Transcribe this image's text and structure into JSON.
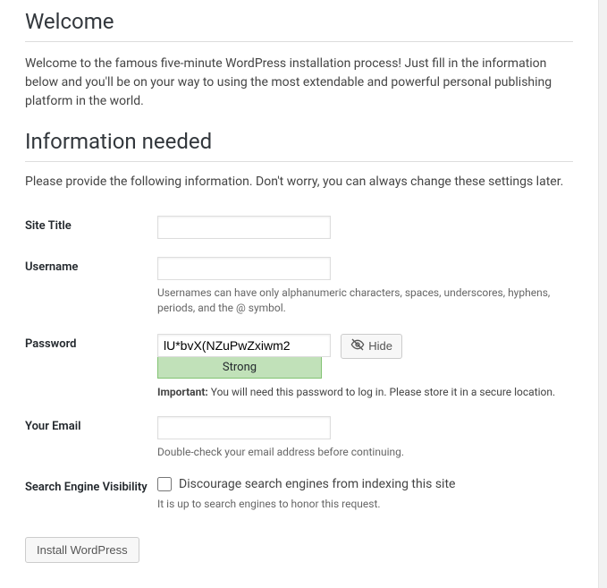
{
  "headings": {
    "welcome": "Welcome",
    "info_needed": "Information needed"
  },
  "intro_text": "Welcome to the famous five-minute WordPress installation process! Just fill in the information below and you'll be on your way to using the most extendable and powerful personal publishing platform in the world.",
  "sub_text": "Please provide the following information. Don't worry, you can always change these settings later.",
  "form": {
    "site_title": {
      "label": "Site Title",
      "value": ""
    },
    "username": {
      "label": "Username",
      "value": "",
      "hint": "Usernames can have only alphanumeric characters, spaces, underscores, hyphens, periods, and the @ symbol."
    },
    "password": {
      "label": "Password",
      "value": "lU*bvX(NZuPwZxiwm2",
      "strength": "Strong",
      "hide_label": "Hide",
      "note_strong": "Important:",
      "note_text": " You will need this password to log in. Please store it in a secure location."
    },
    "email": {
      "label": "Your Email",
      "value": "",
      "hint": "Double-check your email address before continuing."
    },
    "search": {
      "label": "Search Engine Visibility",
      "checkbox_label": "Discourage search engines from indexing this site",
      "hint": "It is up to search engines to honor this request."
    }
  },
  "install_button": "Install WordPress"
}
